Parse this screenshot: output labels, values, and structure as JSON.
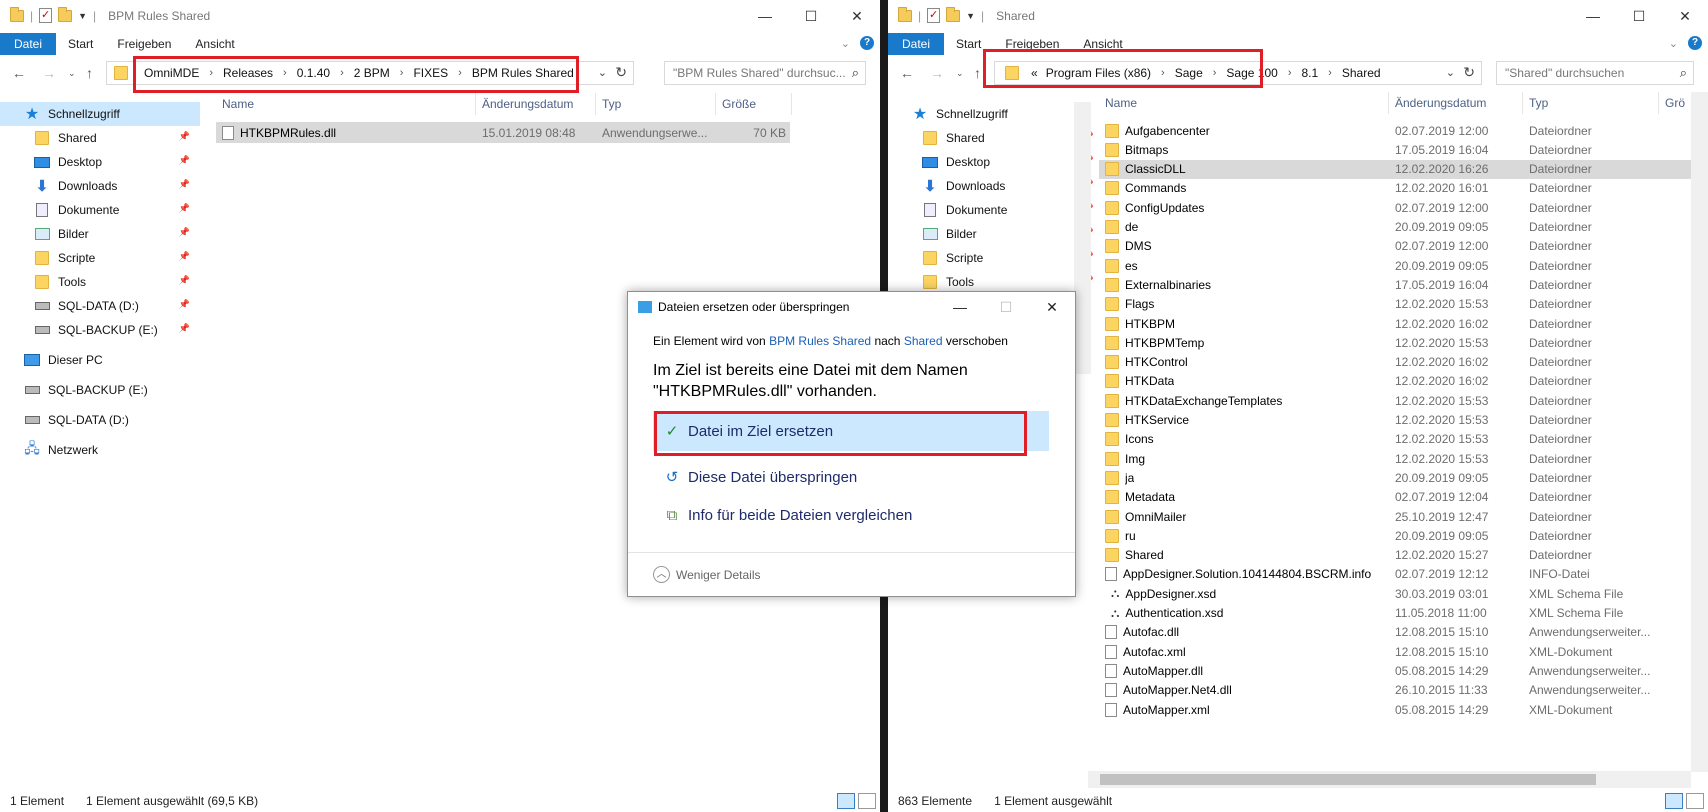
{
  "left_window": {
    "title": "BPM Rules Shared",
    "ribbon_tabs": [
      "Datei",
      "Start",
      "Freigeben",
      "Ansicht"
    ],
    "breadcrumbs": [
      "OmniMDE",
      "Releases",
      "0.1.40",
      "2 BPM",
      "FIXES",
      "BPM Rules Shared"
    ],
    "search_placeholder": "\"BPM Rules Shared\" durchsuc...",
    "nav_items": [
      {
        "label": "Schnellzugriff",
        "icon": "star-icon"
      },
      {
        "label": "Shared",
        "icon": "folder-icon",
        "pinned": true
      },
      {
        "label": "Desktop",
        "icon": "desktop-icon",
        "pinned": true
      },
      {
        "label": "Downloads",
        "icon": "download-icon",
        "pinned": true
      },
      {
        "label": "Dokumente",
        "icon": "document-icon",
        "pinned": true
      },
      {
        "label": "Bilder",
        "icon": "pictures-icon",
        "pinned": true
      },
      {
        "label": "Scripte",
        "icon": "folder-icon",
        "pinned": true
      },
      {
        "label": "Tools",
        "icon": "folder-icon",
        "pinned": true
      },
      {
        "label": "SQL-DATA (D:)",
        "icon": "drive-icon",
        "pinned": true
      },
      {
        "label": "SQL-BACKUP (E:)",
        "icon": "drive-icon",
        "pinned": true
      },
      {
        "label": "Dieser PC",
        "icon": "computer-icon"
      },
      {
        "label": "SQL-BACKUP (E:)",
        "icon": "drive-icon"
      },
      {
        "label": "SQL-DATA (D:)",
        "icon": "drive-icon"
      },
      {
        "label": "Netzwerk",
        "icon": "network-icon"
      }
    ],
    "columns": [
      "Name",
      "Änderungsdatum",
      "Typ",
      "Größe"
    ],
    "files": [
      {
        "name": "HTKBPMRules.dll",
        "date": "15.01.2019 08:48",
        "type": "Anwendungserwe...",
        "size": "70 KB"
      }
    ],
    "status_count": "1 Element",
    "status_selected": "1 Element ausgewählt (69,5 KB)"
  },
  "right_window": {
    "title": "Shared",
    "ribbon_tabs": [
      "Datei",
      "Start",
      "Freigeben",
      "Ansicht"
    ],
    "breadcrumb_overflow": "«",
    "breadcrumbs": [
      "Program Files (x86)",
      "Sage",
      "Sage 100",
      "8.1",
      "Shared"
    ],
    "search_placeholder": "\"Shared\" durchsuchen",
    "nav_items": [
      {
        "label": "Schnellzugriff",
        "icon": "star-icon"
      },
      {
        "label": "Shared",
        "icon": "folder-icon",
        "pinned": true
      },
      {
        "label": "Desktop",
        "icon": "desktop-icon",
        "pinned": true
      },
      {
        "label": "Downloads",
        "icon": "download-icon",
        "pinned": true
      },
      {
        "label": "Dokumente",
        "icon": "document-icon",
        "pinned": true
      },
      {
        "label": "Bilder",
        "icon": "pictures-icon",
        "pinned": true
      },
      {
        "label": "Scripte",
        "icon": "folder-icon",
        "pinned": true
      },
      {
        "label": "Tools",
        "icon": "folder-icon",
        "pinned": true
      }
    ],
    "columns": [
      "Name",
      "Änderungsdatum",
      "Typ",
      "Grö"
    ],
    "files": [
      {
        "name": "Aufgabencenter",
        "date": "02.07.2019 12:00",
        "type": "Dateiordner",
        "kind": "folder"
      },
      {
        "name": "Bitmaps",
        "date": "17.05.2019 16:04",
        "type": "Dateiordner",
        "kind": "folder"
      },
      {
        "name": "ClassicDLL",
        "date": "12.02.2020 16:26",
        "type": "Dateiordner",
        "kind": "folder"
      },
      {
        "name": "Commands",
        "date": "12.02.2020 16:01",
        "type": "Dateiordner",
        "kind": "folder"
      },
      {
        "name": "ConfigUpdates",
        "date": "02.07.2019 12:00",
        "type": "Dateiordner",
        "kind": "folder"
      },
      {
        "name": "de",
        "date": "20.09.2019 09:05",
        "type": "Dateiordner",
        "kind": "folder"
      },
      {
        "name": "DMS",
        "date": "02.07.2019 12:00",
        "type": "Dateiordner",
        "kind": "folder"
      },
      {
        "name": "es",
        "date": "20.09.2019 09:05",
        "type": "Dateiordner",
        "kind": "folder"
      },
      {
        "name": "Externalbinaries",
        "date": "17.05.2019 16:04",
        "type": "Dateiordner",
        "kind": "folder"
      },
      {
        "name": "Flags",
        "date": "12.02.2020 15:53",
        "type": "Dateiordner",
        "kind": "folder"
      },
      {
        "name": "HTKBPM",
        "date": "12.02.2020 16:02",
        "type": "Dateiordner",
        "kind": "folder"
      },
      {
        "name": "HTKBPMTemp",
        "date": "12.02.2020 15:53",
        "type": "Dateiordner",
        "kind": "folder"
      },
      {
        "name": "HTKControl",
        "date": "12.02.2020 16:02",
        "type": "Dateiordner",
        "kind": "folder"
      },
      {
        "name": "HTKData",
        "date": "12.02.2020 16:02",
        "type": "Dateiordner",
        "kind": "folder"
      },
      {
        "name": "HTKDataExchangeTemplates",
        "date": "12.02.2020 15:53",
        "type": "Dateiordner",
        "kind": "folder"
      },
      {
        "name": "HTKService",
        "date": "12.02.2020 15:53",
        "type": "Dateiordner",
        "kind": "folder"
      },
      {
        "name": "Icons",
        "date": "12.02.2020 15:53",
        "type": "Dateiordner",
        "kind": "folder"
      },
      {
        "name": "Img",
        "date": "12.02.2020 15:53",
        "type": "Dateiordner",
        "kind": "folder"
      },
      {
        "name": "ja",
        "date": "20.09.2019 09:05",
        "type": "Dateiordner",
        "kind": "folder"
      },
      {
        "name": "Metadata",
        "date": "02.07.2019 12:04",
        "type": "Dateiordner",
        "kind": "folder"
      },
      {
        "name": "OmniMailer",
        "date": "25.10.2019 12:47",
        "type": "Dateiordner",
        "kind": "folder"
      },
      {
        "name": "ru",
        "date": "20.09.2019 09:05",
        "type": "Dateiordner",
        "kind": "folder"
      },
      {
        "name": "Shared",
        "date": "12.02.2020 15:27",
        "type": "Dateiordner",
        "kind": "folder"
      },
      {
        "name": "AppDesigner.Solution.104144804.BSCRM.info",
        "date": "02.07.2019 12:12",
        "type": "INFO-Datei",
        "kind": "file"
      },
      {
        "name": "AppDesigner.xsd",
        "date": "30.03.2019 03:01",
        "type": "XML Schema File",
        "kind": "xsd"
      },
      {
        "name": "Authentication.xsd",
        "date": "11.05.2018 11:00",
        "type": "XML Schema File",
        "kind": "xsd"
      },
      {
        "name": "Autofac.dll",
        "date": "12.08.2015 15:10",
        "type": "Anwendungserweiter...",
        "kind": "file"
      },
      {
        "name": "Autofac.xml",
        "date": "12.08.2015 15:10",
        "type": "XML-Dokument",
        "kind": "file"
      },
      {
        "name": "AutoMapper.dll",
        "date": "05.08.2015 14:29",
        "type": "Anwendungserweiter...",
        "kind": "file"
      },
      {
        "name": "AutoMapper.Net4.dll",
        "date": "26.10.2015 11:33",
        "type": "Anwendungserweiter...",
        "kind": "file"
      },
      {
        "name": "AutoMapper.xml",
        "date": "05.08.2015 14:29",
        "type": "XML-Dokument",
        "kind": "file"
      }
    ],
    "selected_index": 2,
    "status_count": "863 Elemente",
    "status_selected": "1 Element ausgewählt"
  },
  "dialog": {
    "title": "Dateien ersetzen oder überspringen",
    "move_prefix": "Ein Element wird von",
    "move_source": "BPM Rules Shared",
    "move_mid": "nach",
    "move_target": "Shared",
    "move_suffix": "verschoben",
    "heading": "Im Ziel ist bereits eine Datei mit dem Namen \"HTKBPMRules.dll\" vorhanden.",
    "options": [
      {
        "label": "Datei im Ziel ersetzen",
        "icon": "checkmark-icon"
      },
      {
        "label": "Diese Datei überspringen",
        "icon": "skip-icon"
      },
      {
        "label": "Info für beide Dateien vergleichen",
        "icon": "compare-icon"
      }
    ],
    "less_details": "Weniger Details"
  },
  "colors": {
    "accent": "#1979ca",
    "highlight": "#cce8ff",
    "annotation_red": "#e01e26",
    "folder": "#fcd462"
  }
}
